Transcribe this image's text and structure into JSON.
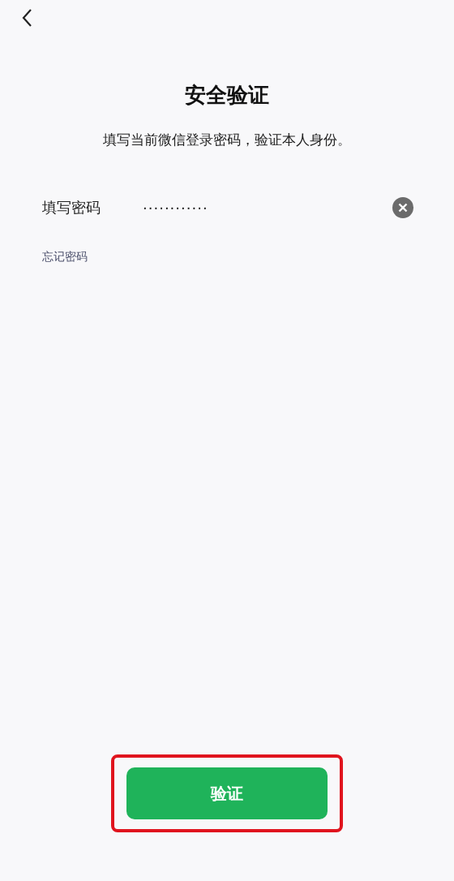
{
  "title": "安全验证",
  "subtitle": "填写当前微信登录密码，验证本人身份。",
  "password_field": {
    "label": "填写密码",
    "value": "············"
  },
  "forgot_link": "忘记密码",
  "verify_button": {
    "label": "验证",
    "highlighted": true
  }
}
